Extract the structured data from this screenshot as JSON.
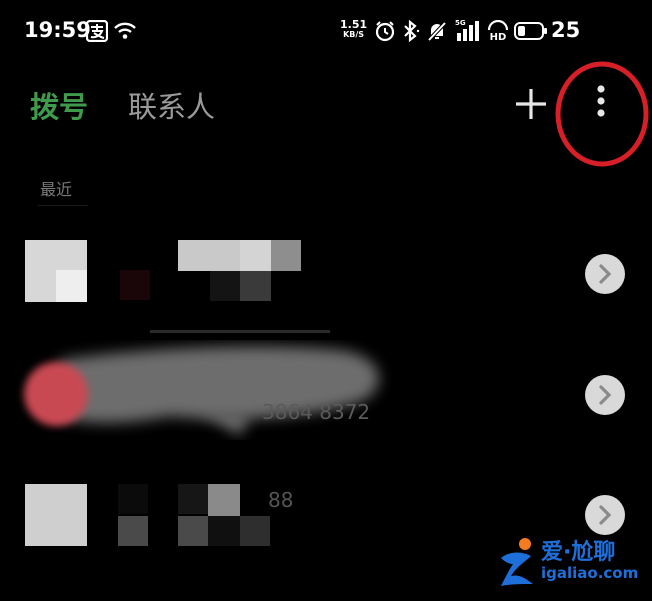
{
  "status_bar": {
    "time": "19:59",
    "speed_value": "1.51",
    "speed_unit": "KB/S",
    "network_label": "5G",
    "battery": "25",
    "icons": [
      "alipay-icon",
      "wifi-icon",
      "alarm-icon",
      "bluetooth-icon",
      "mute-icon",
      "signal-icon",
      "hd-icon",
      "battery-icon"
    ]
  },
  "tabs": {
    "dial": "拨号",
    "contacts": "联系人"
  },
  "toolbar": {
    "add_icon": "plus-icon",
    "menu_icon": "more-vert-icon",
    "highlight_color": "#d61f26"
  },
  "recent": {
    "label": "最近",
    "rows": [
      {
        "avatar_color": "#cfcfcf",
        "detail_icon": "chevron-right-icon"
      },
      {
        "avatar_color": "#c94a52",
        "number_partial": "3864 8372",
        "detail_icon": "chevron-right-icon"
      },
      {
        "avatar_color": "#cfcfcf",
        "number_partial": "88",
        "detail_icon": "chevron-right-icon"
      }
    ]
  },
  "watermark": {
    "title": "爱·尬聊",
    "url": "igaliao.com",
    "color": "#1e6fd9",
    "accent": "#f57b1f"
  },
  "colors": {
    "accent_green": "#3f9a4b",
    "background": "#000000"
  }
}
